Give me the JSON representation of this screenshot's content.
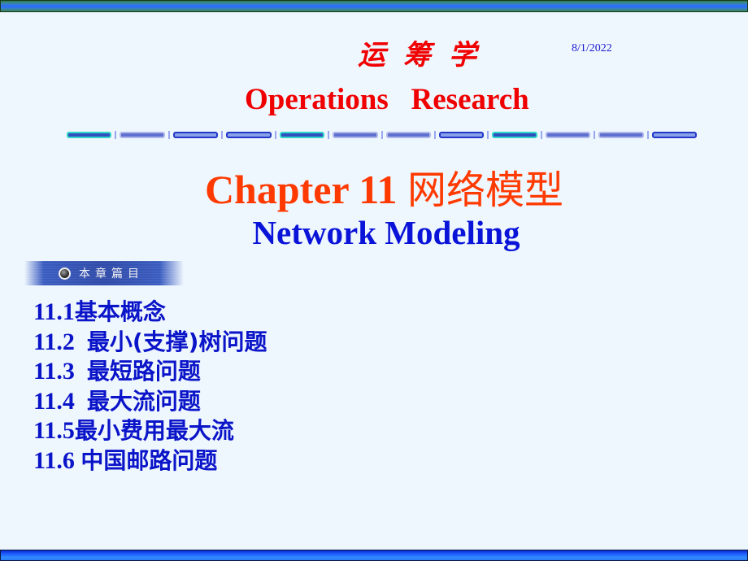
{
  "header": {
    "course_title_cn": "运筹学",
    "course_title_en": "Operations   Research",
    "date": "8/1/2022"
  },
  "chapter": {
    "title_prefix": "Chapter 11 ",
    "title_cn": "网络模型",
    "subtitle": "Network Modeling"
  },
  "toc_banner": {
    "icon": "bullet-circle-icon",
    "label": "本章篇目"
  },
  "toc": [
    {
      "num": "11.1",
      "sep": "",
      "text": "基本概念"
    },
    {
      "num": "11.2",
      "sep": "  ",
      "text": "最小(支撑)树问题"
    },
    {
      "num": "11.3",
      "sep": "  ",
      "text": "最短路问题"
    },
    {
      "num": "11.4",
      "sep": "  ",
      "text": "最大流问题"
    },
    {
      "num": "11.5",
      "sep": "",
      "text": "最小费用最大流"
    },
    {
      "num": "11.6",
      "sep": " ",
      "text": "中国邮路问题"
    }
  ],
  "colors": {
    "background": "#eef6fe",
    "title_red": "#f00000",
    "chapter_orange": "#ff3a00",
    "text_blue": "#0a14c8"
  }
}
